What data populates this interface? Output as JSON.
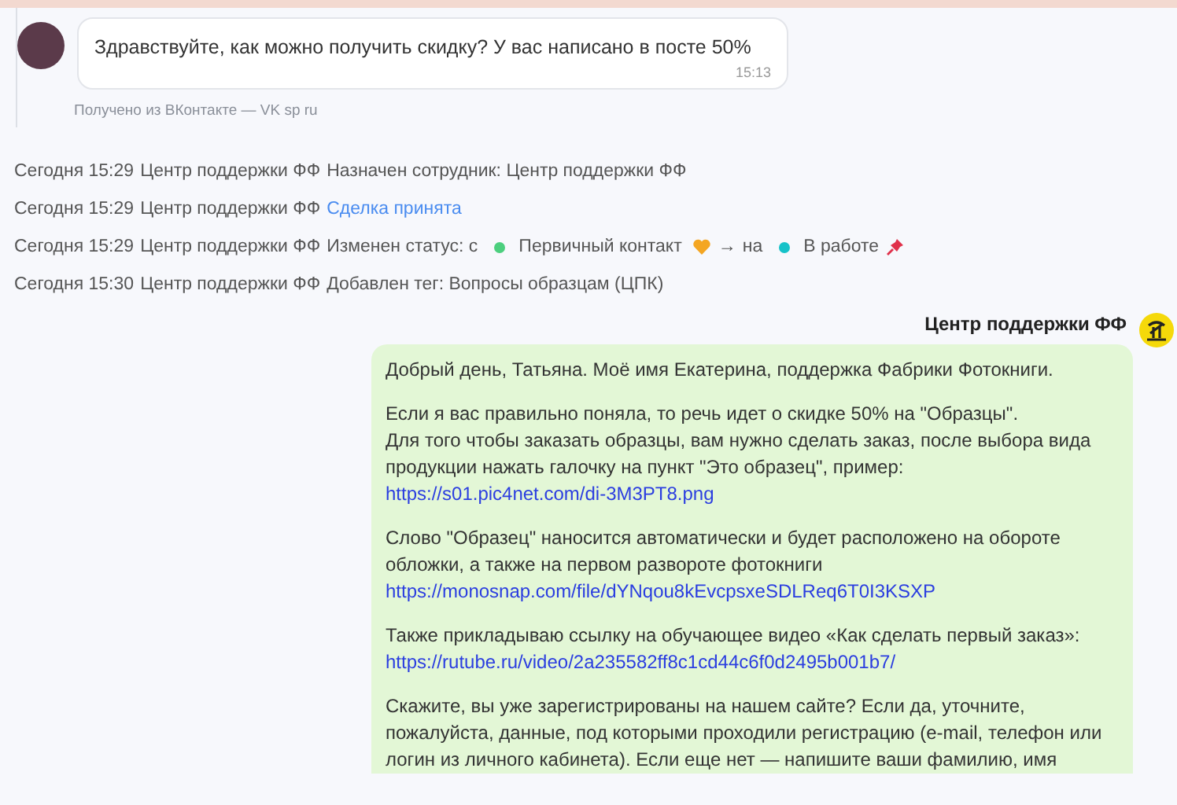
{
  "customer_message": {
    "text": "Здравствуйте, как можно получить скидку? У вас написано в посте 50%",
    "time": "15:13",
    "source": "Получено из ВКонтакте — VK sp ru"
  },
  "events": [
    {
      "date": "Сегодня 15:29",
      "author": "Центр поддержки ФФ",
      "parts": [
        {
          "kind": "text",
          "text": "Назначен сотрудник: Центр поддержки ФФ"
        }
      ]
    },
    {
      "date": "Сегодня 15:29",
      "author": "Центр поддержки ФФ",
      "parts": [
        {
          "kind": "link",
          "text": "Сделка принята"
        }
      ]
    },
    {
      "date": "Сегодня 15:29",
      "author": "Центр поддержки ФФ",
      "parts": [
        {
          "kind": "text",
          "text": "Изменен статус: с"
        },
        {
          "kind": "status",
          "text": "Первичный контакт",
          "color": "#4ccf7e"
        },
        {
          "kind": "heart"
        },
        {
          "kind": "text",
          "text": "→"
        },
        {
          "kind": "text",
          "text": "на"
        },
        {
          "kind": "status",
          "text": "В работе",
          "color": "#16c2c9"
        },
        {
          "kind": "pin"
        }
      ]
    },
    {
      "date": "Сегодня 15:30",
      "author": "Центр поддержки ФФ",
      "parts": [
        {
          "kind": "text",
          "text": "Добавлен тег: Вопросы образцам (ЦПК)"
        }
      ]
    }
  ],
  "agent_message": {
    "author": "Центр поддержки ФФ",
    "paragraphs": [
      [
        {
          "kind": "text",
          "text": "Добрый день, Татьяна. Моё имя Екатерина, поддержка Фабрики Фотокниги."
        }
      ],
      [
        {
          "kind": "text",
          "text": "Если я вас правильно поняла, то речь идет о скидке 50% на \"Образцы\"."
        },
        {
          "kind": "text",
          "text": "Для того чтобы заказать образцы, вам нужно сделать заказ, после выбора вида продукции нажать галочку на пункт \"Это образец\", пример:"
        },
        {
          "kind": "link",
          "text": "https://s01.pic4net.com/di-3M3PT8.png"
        }
      ],
      [
        {
          "kind": "text",
          "text": "Слово \"Образец\" наносится автоматически и будет расположено на обороте обложки, а также на первом развороте фотокниги"
        },
        {
          "kind": "link",
          "text": "https://monosnap.com/file/dYNqou8kEvcpsxeSDLReq6T0I3KSXP"
        }
      ],
      [
        {
          "kind": "text",
          "text": "Также прикладываю ссылку на обучающее видео «Как сделать первый заказ»:"
        },
        {
          "kind": "link",
          "text": "https://rutube.ru/video/2a235582ff8c1cd44c6f0d2495b001b7/"
        }
      ],
      [
        {
          "kind": "text",
          "text": "Скажите, вы уже зарегистрированы на нашем сайте? Если да, уточните, пожалуйста, данные, под которыми проходили регистрацию (e-mail, телефон или логин из личного кабинета). Если еще нет — напишите ваши фамилию, имя"
        }
      ]
    ]
  }
}
